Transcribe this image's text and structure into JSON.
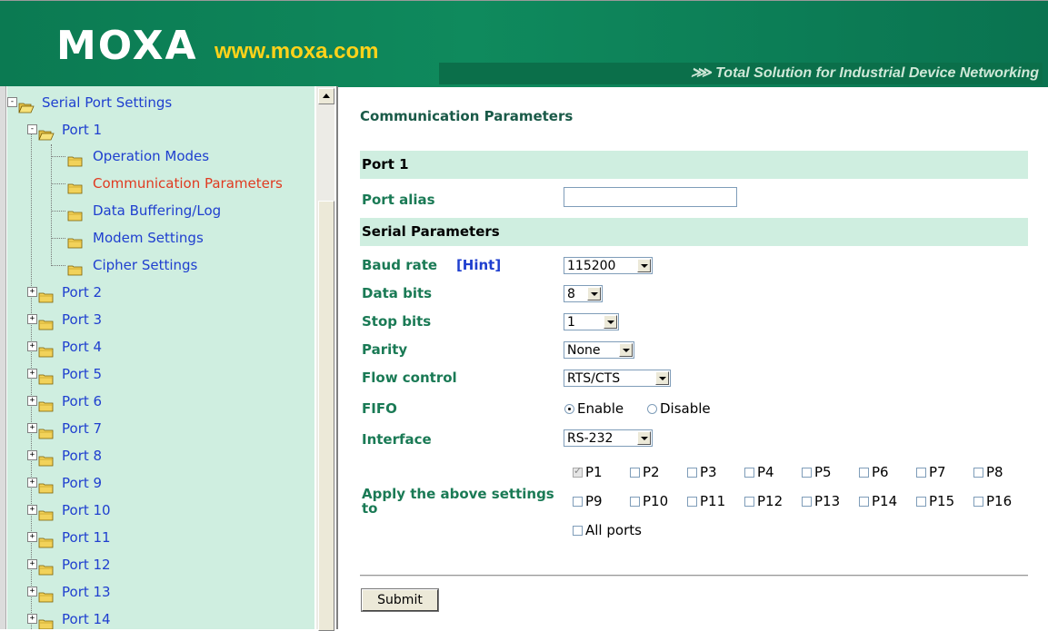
{
  "header": {
    "logo": "MOXA",
    "url": "www.moxa.com",
    "tagline": "⋙ Total Solution for Industrial Device Networking",
    "bg_color": "#0f8a5d",
    "url_color": "#ffd21a"
  },
  "tree": {
    "bg_color": "#cfeee0",
    "root": "Serial Port Settings",
    "port1": "Port 1",
    "port1_children": [
      "Operation Modes",
      "Communication Parameters",
      "Data Buffering/Log",
      "Modem Settings",
      "Cipher Settings"
    ],
    "ports": [
      "Port 2",
      "Port 3",
      "Port 4",
      "Port 5",
      "Port 6",
      "Port 7",
      "Port 8",
      "Port 9",
      "Port 10",
      "Port 11",
      "Port 12",
      "Port 13",
      "Port 14"
    ],
    "current": "Communication Parameters",
    "link_color": "#1f3fcf",
    "current_color": "#e03a20"
  },
  "main": {
    "title": "Communication Parameters",
    "port_band": "Port 1",
    "port_alias_label": "Port alias",
    "port_alias_value": "",
    "serial_band": "Serial Parameters",
    "baud_label": "Baud rate",
    "hint_label": "[Hint]",
    "baud_value": "115200",
    "data_bits_label": "Data bits",
    "data_bits_value": "8",
    "stop_bits_label": "Stop bits",
    "stop_bits_value": "1",
    "parity_label": "Parity",
    "parity_value": "None",
    "flow_label": "Flow control",
    "flow_value": "RTS/CTS",
    "fifo_label": "FIFO",
    "fifo_enable": "Enable",
    "fifo_disable": "Disable",
    "fifo_selected": "Enable",
    "interface_label": "Interface",
    "interface_value": "RS-232",
    "apply_label": "Apply the above settings to",
    "apply_ports": [
      "P1",
      "P2",
      "P3",
      "P4",
      "P5",
      "P6",
      "P7",
      "P8",
      "P9",
      "P10",
      "P11",
      "P12",
      "P13",
      "P14",
      "P15",
      "P16"
    ],
    "apply_checked": [
      "P1"
    ],
    "all_ports_label": "All ports",
    "submit_label": "Submit",
    "label_color": "#1a7a55",
    "band_color": "#cfeee0"
  }
}
